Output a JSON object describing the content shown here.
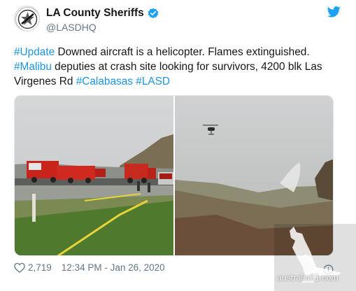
{
  "account": {
    "display_name": "LA County Sheriffs",
    "handle": "@LASDHQ",
    "verified": true,
    "avatar_icon": "lasd-badge-icon"
  },
  "tweet": {
    "parts": [
      {
        "text": "#Update",
        "hashtag": true
      },
      {
        "text": " Downed aircraft is a helicopter. Flames extinguished. ",
        "hashtag": false
      },
      {
        "text": "#Malibu",
        "hashtag": true
      },
      {
        "text": " deputies at crash site looking for survivors, 4200 blk Las Virgenes Rd ",
        "hashtag": false
      },
      {
        "text": "#Calabasas",
        "hashtag": true
      },
      {
        "text": " ",
        "hashtag": false
      },
      {
        "text": "#LASD",
        "hashtag": true
      }
    ]
  },
  "footer": {
    "likes": "2,719",
    "timestamp": "12:34 PM - Jan 26, 2020"
  },
  "watermark": {
    "text": "australia51.com"
  },
  "colors": {
    "link": "#1b95e0",
    "muted": "#657786",
    "brand": "#1da1f2"
  }
}
